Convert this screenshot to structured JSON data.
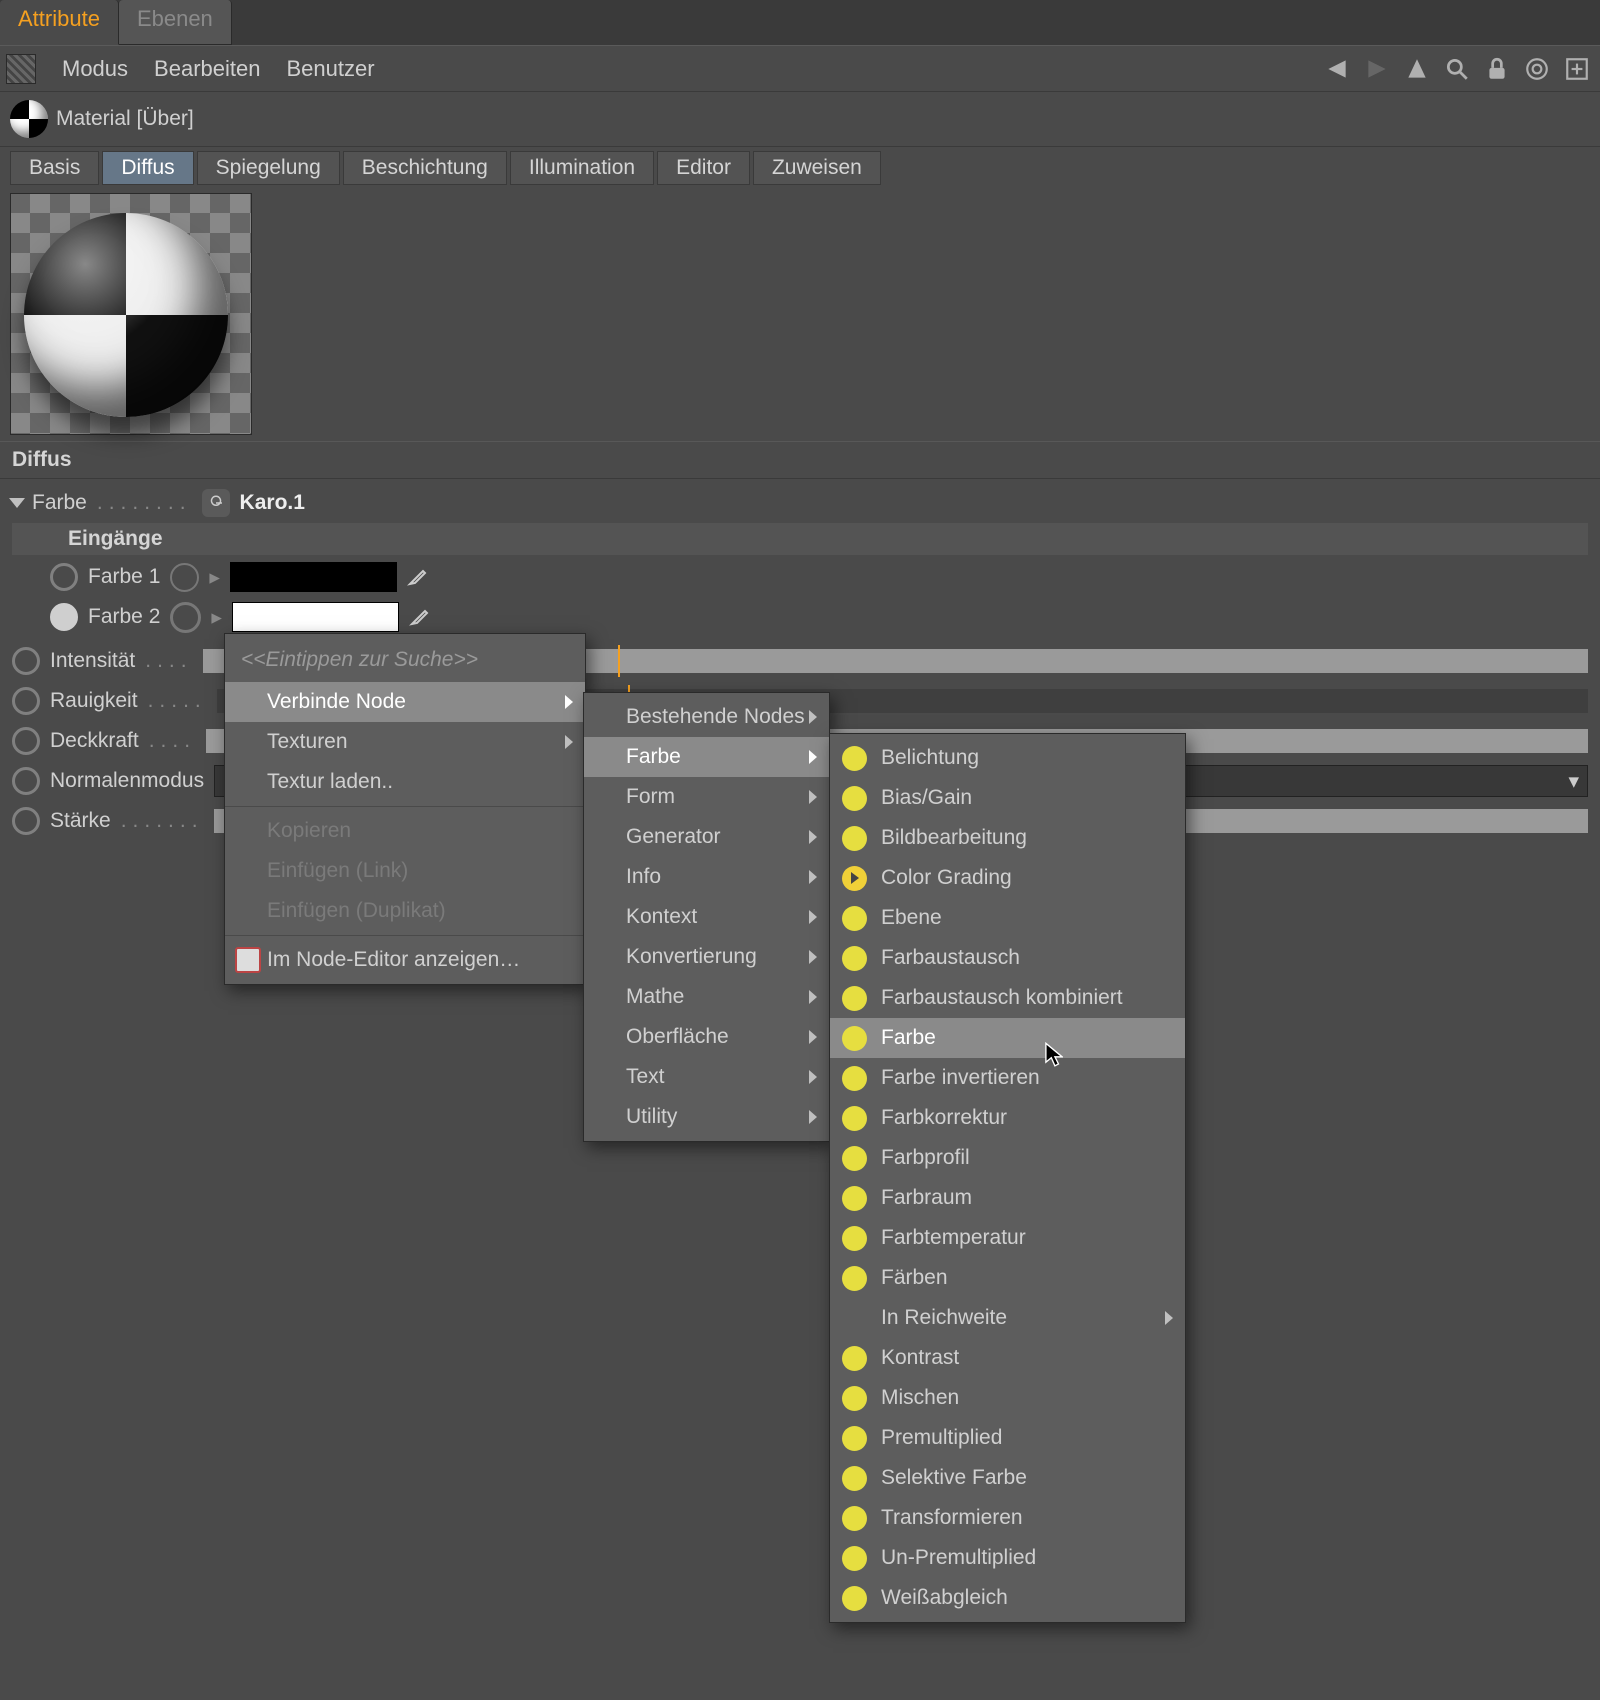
{
  "tabs": {
    "attribute": "Attribute",
    "ebenen": "Ebenen"
  },
  "menubar": {
    "modus": "Modus",
    "bearbeiten": "Bearbeiten",
    "benutzer": "Benutzer"
  },
  "material": {
    "title": "Material [Über]"
  },
  "channels": [
    "Basis",
    "Diffus",
    "Spiegelung",
    "Beschichtung",
    "Illumination",
    "Editor",
    "Zuweisen"
  ],
  "section": "Diffus",
  "farbe": {
    "label": "Farbe",
    "value": "Karo.1"
  },
  "eingaenge": "Eingänge",
  "farbe1": "Farbe 1",
  "farbe2": "Farbe 2",
  "intensitaet": "Intensität",
  "rauigkeit": "Rauigkeit",
  "deckkraft": "Deckkraft",
  "normalenmodus": "Normalenmodus",
  "staerke": "Stärke",
  "ctx1": {
    "search": "<<Eintippen zur Suche>>",
    "verbinde": "Verbinde Node",
    "texturen": "Texturen",
    "laden": "Textur laden..",
    "kopieren": "Kopieren",
    "einf_link": "Einfügen (Link)",
    "einf_dup": "Einfügen (Duplikat)",
    "in_editor": "Im Node-Editor anzeigen…"
  },
  "ctx2": {
    "bestehende": "Bestehende Nodes",
    "farbe": "Farbe",
    "form": "Form",
    "generator": "Generator",
    "info": "Info",
    "kontext": "Kontext",
    "konvertierung": "Konvertierung",
    "mathe": "Mathe",
    "oberflaeche": "Oberfläche",
    "text": "Text",
    "utility": "Utility"
  },
  "ctx3": [
    "Belichtung",
    "Bias/Gain",
    "Bildbearbeitung",
    "Color Grading",
    "Ebene",
    "Farbaustausch",
    "Farbaustausch kombiniert",
    "Farbe",
    "Farbe invertieren",
    "Farbkorrektur",
    "Farbprofil",
    "Farbraum",
    "Farbtemperatur",
    "Färben",
    "In Reichweite",
    "Kontrast",
    "Mischen",
    "Premultiplied",
    "Selektive Farbe",
    "Transformieren",
    "Un-Premultiplied",
    "Weißabgleich"
  ],
  "ctx3_highlight": "Farbe",
  "ctx3_submenu": "In Reichweite",
  "ctx3_play": "Color Grading"
}
